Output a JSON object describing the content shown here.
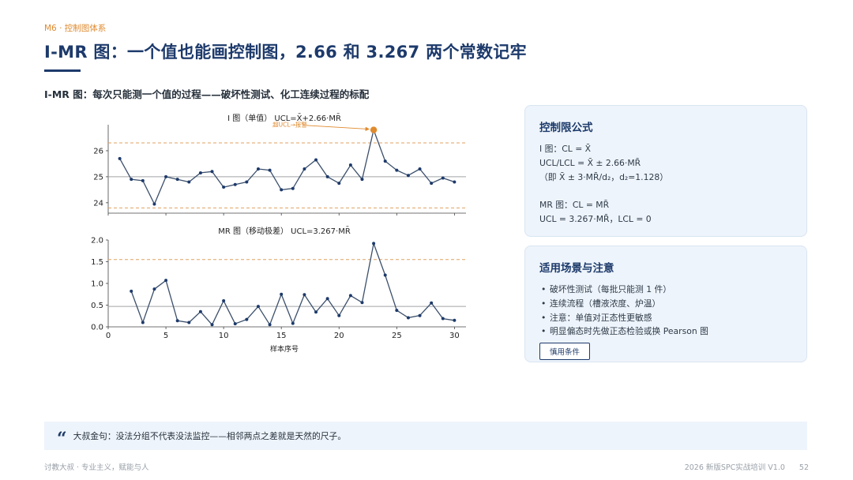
{
  "header": {
    "section_tag": "M6 · 控制图体系",
    "title": "I-MR 图：一个值也能画控制图，2.66 和 3.267 两个常数记牢",
    "subtitle": "I-MR 图：每次只能测一个值的过程——破坏性测试、化工连续过程的标配"
  },
  "formula_card": {
    "title": "控制限公式",
    "lines": [
      "I 图：CL = X̄",
      "UCL/LCL = X̄ ± 2.66·MR̄",
      "（即 X̄ ± 3·MR̄/d₂，d₂=1.128）",
      "",
      "MR 图：CL = MR̄",
      "UCL = 3.267·MR̄，LCL = 0"
    ]
  },
  "usage_card": {
    "title": "适用场景与注意",
    "items": [
      "破坏性测试（每批只能测 1 件）",
      "连续流程（槽液浓度、炉温）",
      "注意：单值对正态性更敏感",
      "明显偏态时先做正态检验或换 Pearson 图"
    ],
    "button_label": "慎用条件"
  },
  "quote": {
    "icon": "quote-icon",
    "text": "大叔金句：没法分组不代表没法监控——相邻两点之差就是天然的尺子。"
  },
  "footer": {
    "left": "讨教大叔 · 专业主义，赋能与人",
    "course": "2026 新版SPC实战培训 V1.0",
    "page": "52"
  },
  "colors": {
    "accent_orange": "#e08a2e",
    "brand_navy": "#1d3a6b",
    "series_line": "#3b4f6b",
    "limit_line": "#e0a060",
    "center_line": "#a0a4a8",
    "card_bg": "#eef4fb"
  },
  "chart_data": [
    {
      "type": "line",
      "title": "I 图（单值） UCL=X̄+2.66·MR̄",
      "x": [
        1,
        2,
        3,
        4,
        5,
        6,
        7,
        8,
        9,
        10,
        11,
        12,
        13,
        14,
        15,
        16,
        17,
        18,
        19,
        20,
        21,
        22,
        23,
        24,
        25,
        26,
        27,
        28,
        29,
        30
      ],
      "series": [
        {
          "values": [
            25.7,
            24.9,
            24.85,
            23.95,
            25.0,
            24.9,
            24.8,
            25.15,
            25.2,
            24.6,
            24.7,
            24.8,
            25.3,
            25.25,
            24.5,
            24.55,
            25.3,
            25.65,
            25.0,
            24.75,
            25.45,
            24.9,
            26.8,
            25.6,
            25.25,
            25.05,
            25.3,
            24.75,
            24.95,
            24.8
          ]
        }
      ],
      "center_line": 25.0,
      "ucl": 26.3,
      "lcl": 23.8,
      "highlight": {
        "x": 23,
        "y": 26.8,
        "label": "超UCL→报警"
      },
      "xlim": [
        0,
        31
      ],
      "ylim": [
        23.6,
        27.0
      ],
      "yticks": [
        24,
        25,
        26
      ],
      "grid": false
    },
    {
      "type": "line",
      "title": "MR 图（移动极差） UCL=3.267·MR̄",
      "x": [
        2,
        3,
        4,
        5,
        6,
        7,
        8,
        9,
        10,
        11,
        12,
        13,
        14,
        15,
        16,
        17,
        18,
        19,
        20,
        21,
        22,
        23,
        24,
        25,
        26,
        27,
        28,
        29,
        30
      ],
      "series": [
        {
          "values": [
            0.82,
            0.1,
            0.87,
            1.07,
            0.14,
            0.1,
            0.35,
            0.05,
            0.6,
            0.07,
            0.17,
            0.47,
            0.05,
            0.75,
            0.08,
            0.74,
            0.34,
            0.65,
            0.26,
            0.72,
            0.56,
            1.92,
            1.19,
            0.38,
            0.21,
            0.26,
            0.55,
            0.19,
            0.15
          ]
        }
      ],
      "center_line": 0.47,
      "ucl": 1.55,
      "xlabel": "样本序号",
      "xlim": [
        0,
        31
      ],
      "ylim": [
        0,
        2.0
      ],
      "yticks": [
        0.0,
        0.5,
        1.0,
        1.5,
        2.0
      ],
      "xticks": [
        0,
        5,
        10,
        15,
        20,
        25,
        30
      ],
      "grid": false
    }
  ]
}
